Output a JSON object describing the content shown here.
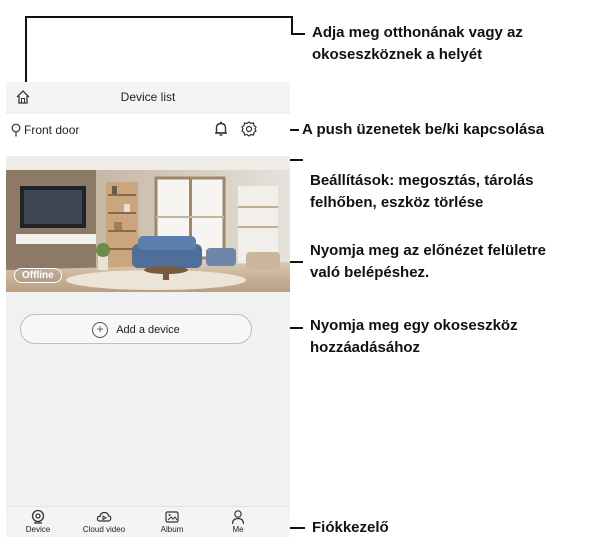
{
  "app": {
    "title": "Device list",
    "location": "Front door",
    "preview_status": "Offline",
    "add_device_label": "Add a device"
  },
  "nav": {
    "items": [
      {
        "label": "Device",
        "icon": "device-icon"
      },
      {
        "label": "Cloud video",
        "icon": "cloud-video-icon"
      },
      {
        "label": "Album",
        "icon": "album-icon"
      },
      {
        "label": "Me",
        "icon": "user-icon"
      }
    ]
  },
  "annotations": {
    "home_line1": "Adja meg otthonának vagy az",
    "home_line2": "okoseszköznek a helyét",
    "push": "A push üzenetek be/ki kapcsolása",
    "settings_line1": "Beállítások: megosztás, tárolás",
    "settings_line2": "felhőben, eszköz törlése",
    "preview_line1": "Nyomja meg az előnézet felületre",
    "preview_line2": "való belépéshez.",
    "add_line1": "Nyomja meg egy okoseszköz",
    "add_line2": "hozzáadásához",
    "account": "Fiókkezelő"
  },
  "colors": {
    "app_background": "#f1f1f3",
    "annotation_text": "#111111"
  }
}
